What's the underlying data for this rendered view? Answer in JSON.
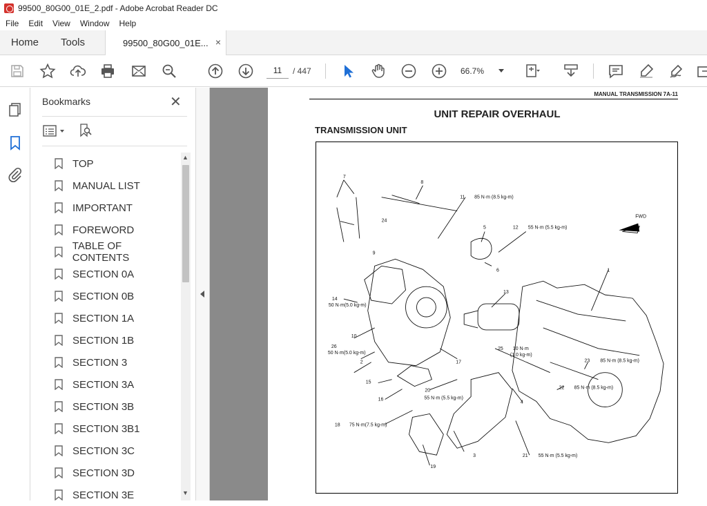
{
  "window": {
    "title": "99500_80G00_01E_2.pdf - Adobe Acrobat Reader DC"
  },
  "menu": [
    "File",
    "Edit",
    "View",
    "Window",
    "Help"
  ],
  "tabs": {
    "home": "Home",
    "tools": "Tools",
    "document": "99500_80G00_01E...",
    "close": "×"
  },
  "toolbar": {
    "page_current": "11",
    "page_total": "/  447",
    "zoom": "66.7%"
  },
  "bookmarks": {
    "title": "Bookmarks",
    "close": "✕",
    "items": [
      "TOP",
      "MANUAL LIST",
      "IMPORTANT",
      "FOREWORD",
      "TABLE OF CONTENTS",
      "SECTION 0A",
      "SECTION 0B",
      "SECTION 1A",
      "SECTION 1B",
      "SECTION 3",
      "SECTION 3A",
      "SECTION 3B",
      "SECTION 3B1",
      "SECTION 3C",
      "SECTION 3D",
      "SECTION 3E"
    ]
  },
  "document": {
    "running_head": "MANUAL TRANSMISSION 7A-11",
    "heading": "UNIT REPAIR OVERHAUL",
    "subheading": "TRANSMISSION UNIT",
    "labels": {
      "l7": "7",
      "l8": "8",
      "l11": "11",
      "t11": "85 N·m (8.5 kg-m)",
      "l24": "24",
      "l5": "5",
      "l12": "12",
      "t12": "55 N·m (5.5 kg-m)",
      "fwd": "FWD",
      "l9": "9",
      "l6": "6",
      "l1": "1",
      "l13": "13",
      "l14": "14",
      "t14": "50 N·m(5.0 kg-m)",
      "l10": "10",
      "l26": "26",
      "t26": "50 N·m(5.0 kg-m)",
      "l25": "25",
      "t25a": "10 N·m",
      "t25b": "(1.0 kg-m)",
      "l2": "2",
      "l17": "17",
      "l23": "23",
      "t23": "85 N·m (8.5 kg-m)",
      "l15": "15",
      "l20": "20",
      "t20": "55 N·m (5.5 kg-m)",
      "l22": "22",
      "t22": "85 N·m (8.5 kg-m)",
      "l16": "16",
      "l4": "4",
      "l18": "18",
      "t18": "75 N·m(7.5 kg-m)",
      "l21": "21",
      "t21": "55 N·m (5.5 kg-m)",
      "l3": "3",
      "l19": "19"
    }
  }
}
